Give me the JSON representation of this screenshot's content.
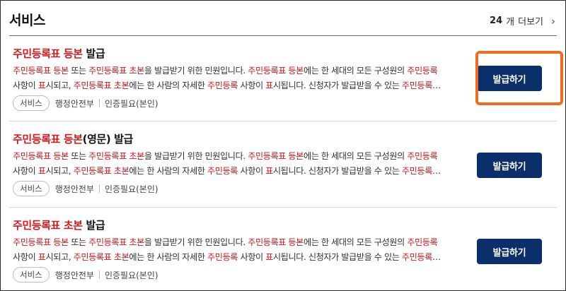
{
  "header": {
    "title": "서비스",
    "count": "24",
    "count_unit": "개",
    "more_label": "더보기",
    "chevron": "›"
  },
  "items": [
    {
      "title_parts": [
        "주민등록표 등본",
        " 발급"
      ],
      "desc_line1": [
        {
          "t": "주민등록표 등본",
          "h": true
        },
        {
          "t": " 또는 ",
          "h": false
        },
        {
          "t": "주민등록표 초본",
          "h": true
        },
        {
          "t": "을 발급받기 위한 민원입니다. ",
          "h": false
        },
        {
          "t": "주민등록표 등본",
          "h": true
        },
        {
          "t": "에는 한 세대의 모든 구성원의 ",
          "h": false
        },
        {
          "t": "주민등록",
          "h": true
        }
      ],
      "desc_line2": [
        {
          "t": "사항이 ",
          "h": false
        },
        {
          "t": "표",
          "h": true
        },
        {
          "t": "시되고, ",
          "h": false
        },
        {
          "t": "주민등록표 초본",
          "h": true
        },
        {
          "t": "에는 한 사람의 자세한 ",
          "h": false
        },
        {
          "t": "주민등록",
          "h": true
        },
        {
          "t": " 사항이 ",
          "h": false
        },
        {
          "t": "표",
          "h": true
        },
        {
          "t": "시됩니다. 신청자가 발급받을 수 있는 ",
          "h": false
        },
        {
          "t": "주민등록",
          "h": true
        },
        {
          "t": "…",
          "h": false
        }
      ],
      "tag": "서비스",
      "agency": "행정안전부",
      "auth": "인증필요(본인)",
      "button": "발급하기"
    },
    {
      "title_parts": [
        "주민등록표 등본",
        "(영문) 발급"
      ],
      "desc_line1": [
        {
          "t": "주민등록표 등본",
          "h": true
        },
        {
          "t": " 또는 ",
          "h": false
        },
        {
          "t": "주민등록표 초본",
          "h": true
        },
        {
          "t": "을 발급받기 위한 민원입니다. ",
          "h": false
        },
        {
          "t": "주민등록표 등본",
          "h": true
        },
        {
          "t": "에는 한 세대의 모든 구성원의 ",
          "h": false
        },
        {
          "t": "주민등록",
          "h": true
        }
      ],
      "desc_line2": [
        {
          "t": "사항이 ",
          "h": false
        },
        {
          "t": "표",
          "h": true
        },
        {
          "t": "시되고, ",
          "h": false
        },
        {
          "t": "주민등록표 초본",
          "h": true
        },
        {
          "t": "에는 한 사람의 자세한 ",
          "h": false
        },
        {
          "t": "주민등록",
          "h": true
        },
        {
          "t": " 사항이 ",
          "h": false
        },
        {
          "t": "표",
          "h": true
        },
        {
          "t": "시됩니다. 신청자가 발급받을 수 있는 ",
          "h": false
        },
        {
          "t": "주민등록",
          "h": true
        },
        {
          "t": "…",
          "h": false
        }
      ],
      "tag": "서비스",
      "agency": "행정안전부",
      "auth": "인증필요(본인)",
      "button": "발급하기"
    },
    {
      "title_parts": [
        "주민등록표 초본",
        " 발급"
      ],
      "desc_line1": [
        {
          "t": "주민등록표 등본",
          "h": true
        },
        {
          "t": " 또는 ",
          "h": false
        },
        {
          "t": "주민등록표 초본",
          "h": true
        },
        {
          "t": "을 발급받기 위한 민원입니다. ",
          "h": false
        },
        {
          "t": "주민등록표 등본",
          "h": true
        },
        {
          "t": "에는 한 세대의 모든 구성원의 ",
          "h": false
        },
        {
          "t": "주민등록",
          "h": true
        }
      ],
      "desc_line2": [
        {
          "t": "사항이 ",
          "h": false
        },
        {
          "t": "표",
          "h": true
        },
        {
          "t": "시되고, ",
          "h": false
        },
        {
          "t": "주민등록표 초본",
          "h": true
        },
        {
          "t": "에는 한 사람의 자세한 ",
          "h": false
        },
        {
          "t": "주민등록",
          "h": true
        },
        {
          "t": " 사항이 ",
          "h": false
        },
        {
          "t": "표",
          "h": true
        },
        {
          "t": "시됩니다. 신청자가 발급받을 수 있는 ",
          "h": false
        },
        {
          "t": "주민등록",
          "h": true
        },
        {
          "t": "…",
          "h": false
        }
      ],
      "tag": "서비스",
      "agency": "행정안전부",
      "auth": "인증필요(본인)",
      "button": "발급하기"
    }
  ],
  "colors": {
    "highlight_text": "#d2181d",
    "button_bg": "#0b2f6b",
    "focus_outline": "#f06b1c"
  },
  "icons": {
    "more": "chevron-right-icon"
  }
}
